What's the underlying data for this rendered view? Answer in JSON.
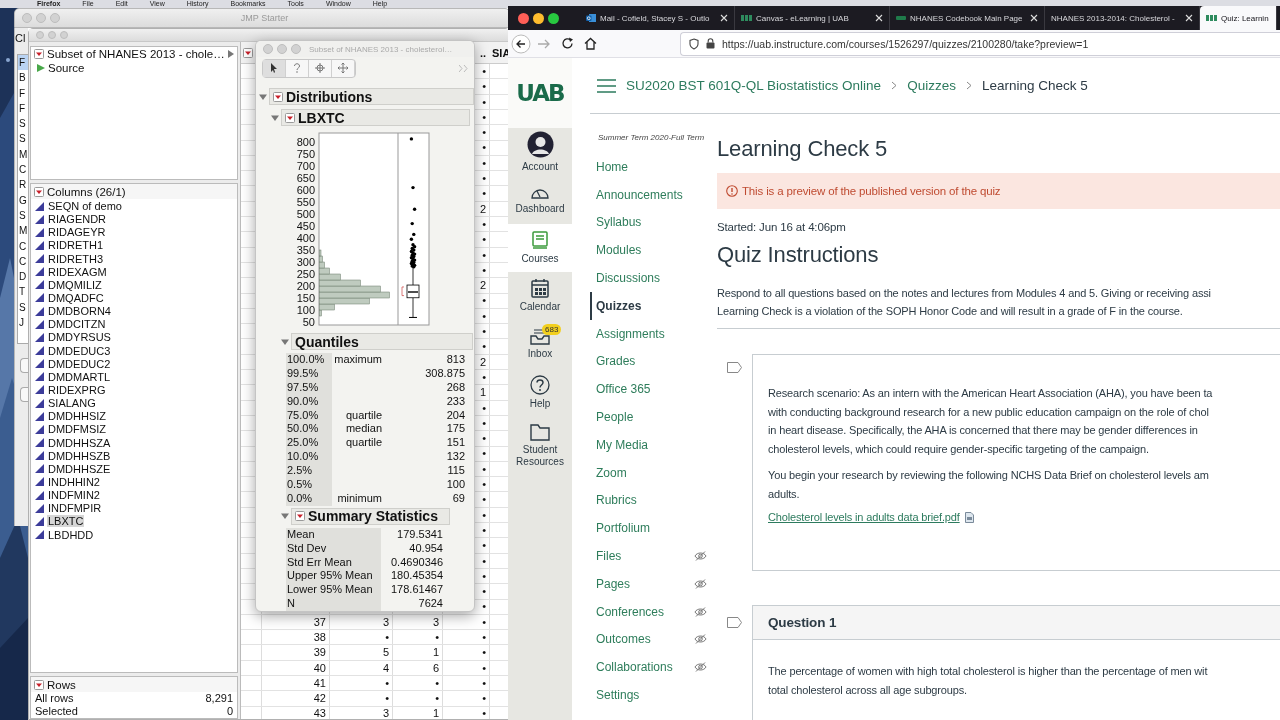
{
  "menu_bar": {
    "items": [
      "Firefox",
      "File",
      "Edit",
      "View",
      "History",
      "Bookmarks",
      "Tools",
      "Window",
      "Help"
    ]
  },
  "jmp_starter": {
    "title": "JMP Starter",
    "label": "Cl",
    "items": [
      {
        "label": "F",
        "selected": true
      },
      {
        "label": "B",
        "selected": false
      },
      {
        "label": "F",
        "selected": false
      },
      {
        "label": "F",
        "selected": false
      },
      {
        "label": "S",
        "selected": false
      },
      {
        "label": "S",
        "selected": false
      },
      {
        "label": "M",
        "selected": false
      },
      {
        "label": "C",
        "selected": false
      },
      {
        "label": "R",
        "selected": false
      },
      {
        "label": "G",
        "selected": false
      },
      {
        "label": "S",
        "selected": false
      },
      {
        "label": "M",
        "selected": false
      },
      {
        "label": "C",
        "selected": false
      },
      {
        "label": "C",
        "selected": false
      },
      {
        "label": "D",
        "selected": false
      },
      {
        "label": "T",
        "selected": false
      },
      {
        "label": "S",
        "selected": false
      },
      {
        "label": "J",
        "selected": false
      }
    ]
  },
  "data_table": {
    "table_name": "Subset of NHANES 2013 - chole…",
    "source": "Source",
    "columns_title": "Columns (26/1)",
    "columns": [
      {
        "name": "SEQN of demo",
        "selected": false
      },
      {
        "name": "RIAGENDR",
        "selected": false
      },
      {
        "name": "RIDAGEYR",
        "selected": false
      },
      {
        "name": "RIDRETH1",
        "selected": false
      },
      {
        "name": "RIDRETH3",
        "selected": false
      },
      {
        "name": "RIDEXAGM",
        "selected": false
      },
      {
        "name": "DMQMILIZ",
        "selected": false
      },
      {
        "name": "DMQADFC",
        "selected": false
      },
      {
        "name": "DMDBORN4",
        "selected": false
      },
      {
        "name": "DMDCITZN",
        "selected": false
      },
      {
        "name": "DMDYRSUS",
        "selected": false
      },
      {
        "name": "DMDEDUC3",
        "selected": false
      },
      {
        "name": "DMDEDUC2",
        "selected": false
      },
      {
        "name": "DMDMARTL",
        "selected": false
      },
      {
        "name": "RIDEXPRG",
        "selected": false
      },
      {
        "name": "SIALANG",
        "selected": false
      },
      {
        "name": "DMDHHSIZ",
        "selected": false
      },
      {
        "name": "DMDFMSIZ",
        "selected": false
      },
      {
        "name": "DMDHHSZA",
        "selected": false
      },
      {
        "name": "DMDHHSZB",
        "selected": false
      },
      {
        "name": "DMDHHSZE",
        "selected": false
      },
      {
        "name": "INDHHIN2",
        "selected": false
      },
      {
        "name": "INDFMIN2",
        "selected": false
      },
      {
        "name": "INDFMPIR",
        "selected": false
      },
      {
        "name": "LBXTC",
        "selected": true
      },
      {
        "name": "LBDHDD",
        "selected": false
      }
    ],
    "rows_title": "Rows",
    "row_counts": [
      {
        "label": "All rows",
        "value": "8,291"
      },
      {
        "label": "Selected",
        "value": "0"
      }
    ],
    "grid_header": [
      "..",
      "SIA"
    ],
    "partly_hidden_rows": [
      "•",
      "•",
      "•",
      "•",
      "•",
      "•",
      "•",
      "•",
      "•",
      "2",
      "•",
      "•",
      "•",
      "•",
      "2",
      "•",
      "•",
      "•",
      "•",
      "2",
      "•",
      "1",
      "•",
      "•",
      "•",
      "•",
      "•",
      "•",
      "•",
      "•",
      "•",
      "•",
      "•",
      "•",
      "•",
      "•"
    ],
    "rows": [
      {
        "number": "37",
        "values": [
          "3",
          "3",
          "•"
        ]
      },
      {
        "number": "38",
        "values": [
          "•",
          "•",
          "•"
        ]
      },
      {
        "number": "39",
        "values": [
          "5",
          "1",
          "•"
        ]
      },
      {
        "number": "40",
        "values": [
          "4",
          "6",
          "•"
        ]
      },
      {
        "number": "41",
        "values": [
          "•",
          "•",
          "•"
        ]
      },
      {
        "number": "42",
        "values": [
          "•",
          "•",
          "•"
        ]
      },
      {
        "number": "43",
        "values": [
          "3",
          "1",
          "•"
        ]
      }
    ]
  },
  "distribution": {
    "title": "Subset of NHANES 2013 - cholesterol…",
    "heading": "Distributions",
    "variable": "LBXTC",
    "axis_ticks": [
      "800",
      "750",
      "700",
      "650",
      "600",
      "550",
      "500",
      "450",
      "400",
      "350",
      "300",
      "250",
      "200",
      "150",
      "100",
      "50"
    ],
    "quantiles_title": "Quantiles",
    "quantiles": [
      {
        "percent": "100.0%",
        "label": "maximum",
        "value": "813"
      },
      {
        "percent": "99.5%",
        "value": "308.875"
      },
      {
        "percent": "97.5%",
        "value": "268"
      },
      {
        "percent": "90.0%",
        "value": "233"
      },
      {
        "percent": "75.0%",
        "label": "quartile",
        "value": "204"
      },
      {
        "percent": "50.0%",
        "label": "median",
        "value": "175"
      },
      {
        "percent": "25.0%",
        "label": "quartile",
        "value": "151"
      },
      {
        "percent": "10.0%",
        "value": "132"
      },
      {
        "percent": "2.5%",
        "value": "115"
      },
      {
        "percent": "0.5%",
        "value": "100"
      },
      {
        "percent": "0.0%",
        "label": "minimum",
        "value": "69"
      }
    ],
    "summary_title": "Summary Statistics",
    "summary": [
      {
        "label": "Mean",
        "value": "179.5341"
      },
      {
        "label": "Std Dev",
        "value": "40.954"
      },
      {
        "label": "Std Err Mean",
        "value": "0.4690346"
      },
      {
        "label": "Upper 95% Mean",
        "value": "180.45354"
      },
      {
        "label": "Lower 95% Mean",
        "value": "178.61467"
      },
      {
        "label": "N",
        "value": "7624"
      }
    ]
  },
  "browser": {
    "tabs": [
      {
        "title": "Mail - Cofield, Stacey S - Outlo",
        "selected": false
      },
      {
        "title": "Canvas - eLearning | UAB",
        "selected": false
      },
      {
        "title": "NHANES Codebook Main Page",
        "selected": false
      },
      {
        "title": "NHANES 2013-2014: Cholesterol -",
        "selected": false
      },
      {
        "title": "Quiz: Learnin",
        "selected": true
      }
    ],
    "url": "https://uab.instructure.com/courses/1526297/quizzes/2100280/take?preview=1"
  },
  "canvas": {
    "logo": "UAB",
    "global_nav": [
      {
        "label": "Account",
        "selected": false
      },
      {
        "label": "Dashboard",
        "selected": false
      },
      {
        "label": "Courses",
        "selected": true
      },
      {
        "label": "Calendar",
        "selected": false
      },
      {
        "label": "Inbox",
        "selected": false,
        "badge": "683"
      },
      {
        "label": "Help",
        "selected": false
      },
      {
        "label": "Student Resources",
        "selected": false
      }
    ],
    "breadcrumbs": [
      {
        "label": "SU2020 BST 601Q-QL Biostatistics Online",
        "current": false
      },
      {
        "label": "Quizzes",
        "current": false
      },
      {
        "label": "Learning Check 5",
        "current": true
      }
    ],
    "term": "Summer Term 2020-Full Term",
    "course_nav": [
      {
        "label": "Home",
        "selected": false,
        "hidden": false
      },
      {
        "label": "Announcements",
        "selected": false,
        "hidden": false
      },
      {
        "label": "Syllabus",
        "selected": false,
        "hidden": false
      },
      {
        "label": "Modules",
        "selected": false,
        "hidden": false
      },
      {
        "label": "Discussions",
        "selected": false,
        "hidden": false
      },
      {
        "label": "Quizzes",
        "selected": true,
        "hidden": false
      },
      {
        "label": "Assignments",
        "selected": false,
        "hidden": false
      },
      {
        "label": "Grades",
        "selected": false,
        "hidden": false
      },
      {
        "label": "Office 365",
        "selected": false,
        "hidden": false
      },
      {
        "label": "People",
        "selected": false,
        "hidden": false
      },
      {
        "label": "My Media",
        "selected": false,
        "hidden": false
      },
      {
        "label": "Zoom",
        "selected": false,
        "hidden": false
      },
      {
        "label": "Rubrics",
        "selected": false,
        "hidden": false
      },
      {
        "label": "Portfolium",
        "selected": false,
        "hidden": false
      },
      {
        "label": "Files",
        "selected": false,
        "hidden": true
      },
      {
        "label": "Pages",
        "selected": false,
        "hidden": true
      },
      {
        "label": "Conferences",
        "selected": false,
        "hidden": true
      },
      {
        "label": "Outcomes",
        "selected": false,
        "hidden": true
      },
      {
        "label": "Collaborations",
        "selected": false,
        "hidden": true
      },
      {
        "label": "Settings",
        "selected": false,
        "hidden": false
      }
    ],
    "title": "Learning Check 5",
    "alert": "This is a preview of the published version of the quiz",
    "started": "Started: Jun 16 at 4:06pm",
    "instructions_title": "Quiz Instructions",
    "instructions": [
      "Respond to all questions based on the notes and lectures from Modules 4 and 5. Giving or receiving assi",
      "Learning Check is a violation of the SOPH Honor Code and will result in a grade of F in the course."
    ],
    "blocks": [
      {
        "kind": "text",
        "paragraphs": [
          [
            "Research scenario: As an intern with the American Heart Association (AHA), you have been ta",
            "with conducting background research for a new public education campaign on the role of chol",
            "in heart disease. Specifically, the AHA is concerned that there may be gender differences in",
            "cholesterol levels, which could require gender-specific targeting of the campaign."
          ],
          [
            "You begin your research by reviewing the following NCHS Data Brief on cholesterol levels am",
            "adults."
          ]
        ],
        "attachment": "Cholesterol levels in adults data brief.pdf"
      },
      {
        "kind": "question",
        "title": "Question 1",
        "paragraphs": [
          [
            "The percentage of women with high total cholesterol is higher than the percentage of men wit",
            "total cholesterol across all age subgroups."
          ]
        ]
      }
    ]
  }
}
